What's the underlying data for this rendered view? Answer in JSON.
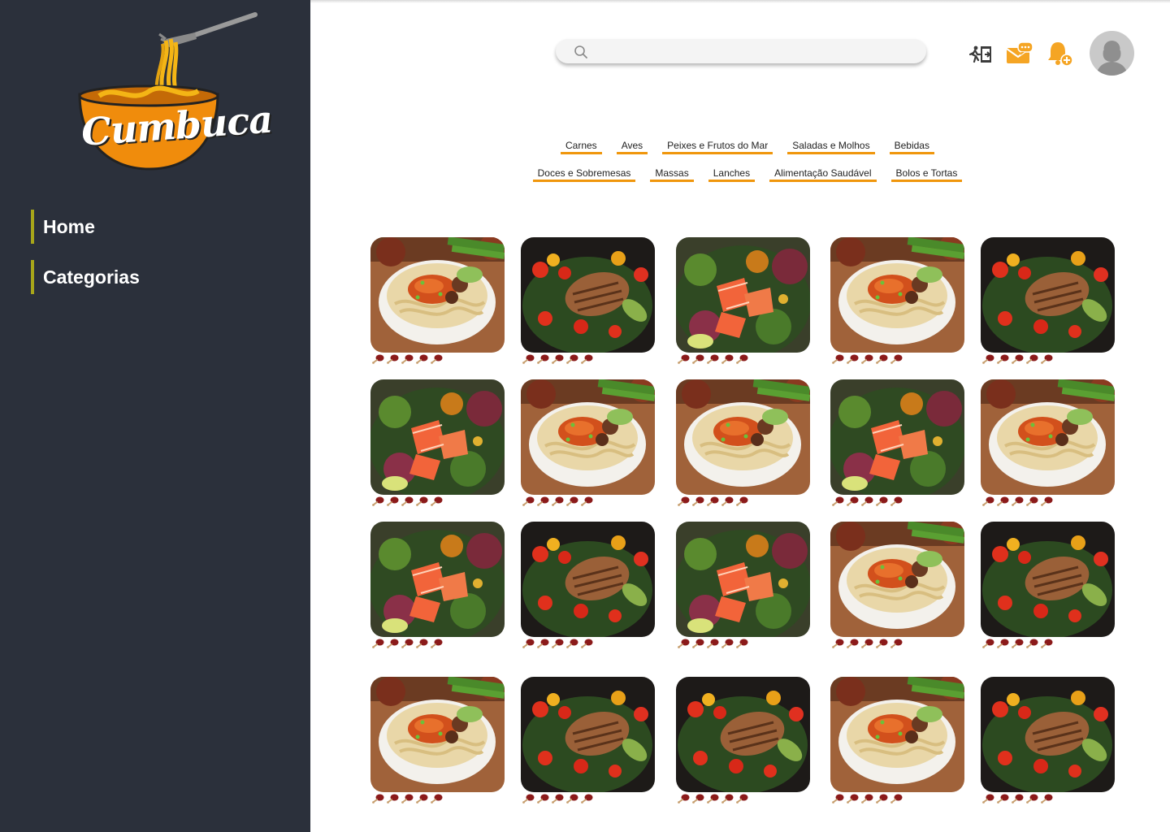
{
  "brand": {
    "logo_text": "Cumbuca"
  },
  "sidebar": {
    "items": [
      {
        "label": "Home"
      },
      {
        "label": "Categorias"
      }
    ]
  },
  "header": {
    "search": {
      "placeholder": "",
      "value": ""
    },
    "icons": [
      "logout-icon",
      "mail-chat-icon",
      "bell-add-icon",
      "avatar-icon"
    ]
  },
  "categories": {
    "row1": [
      "Carnes",
      "Aves",
      "Peixes e Frutos do Mar",
      "Saladas e Molhos",
      "Bebidas"
    ],
    "row2": [
      "Doces e Sobremesas",
      "Massas",
      "Lanches",
      "Alimentação Saudável",
      "Bolos e Tortas"
    ]
  },
  "colors": {
    "sidebar_bg": "#2b303b",
    "accent": "#f0960c",
    "nav_bar": "#a8a61a",
    "rating": "#8b1a1a"
  },
  "recipes": [
    {
      "photo": "noodle-bowl",
      "rating": 5
    },
    {
      "photo": "chicken-salad",
      "rating": 5
    },
    {
      "photo": "salmon-salad",
      "rating": 5
    },
    {
      "photo": "noodle-bowl",
      "rating": 5
    },
    {
      "photo": "chicken-salad",
      "rating": 5
    },
    {
      "photo": "salmon-salad",
      "rating": 5
    },
    {
      "photo": "noodle-bowl",
      "rating": 5
    },
    {
      "photo": "noodle-bowl",
      "rating": 5
    },
    {
      "photo": "salmon-salad",
      "rating": 5
    },
    {
      "photo": "noodle-bowl",
      "rating": 5
    },
    {
      "photo": "salmon-salad",
      "rating": 5
    },
    {
      "photo": "chicken-salad",
      "rating": 5
    },
    {
      "photo": "salmon-salad",
      "rating": 5
    },
    {
      "photo": "noodle-bowl",
      "rating": 5
    },
    {
      "photo": "chicken-salad",
      "rating": 5
    },
    {
      "photo": "noodle-bowl",
      "rating": 5
    },
    {
      "photo": "chicken-salad",
      "rating": 5
    },
    {
      "photo": "chicken-salad",
      "rating": 5
    },
    {
      "photo": "noodle-bowl",
      "rating": 5
    },
    {
      "photo": "chicken-salad",
      "rating": 5
    }
  ]
}
